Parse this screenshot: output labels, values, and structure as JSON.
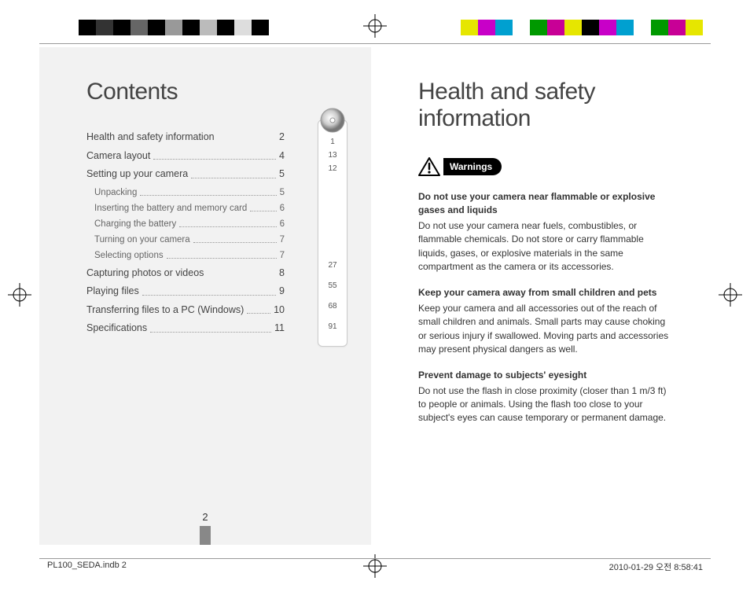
{
  "colorbars": {
    "left": [
      "#000",
      "#333",
      "#000",
      "#666",
      "#000",
      "#999",
      "#000",
      "#bbb",
      "#000",
      "#ddd",
      "#000",
      "#fff"
    ],
    "right": [
      "#e6e600",
      "#c800c8",
      "#00a0d0",
      "#fff",
      "#009900",
      "#c80096",
      "#e6e600",
      "#000",
      "#c800c8",
      "#00a0d0",
      "#fff",
      "#009900",
      "#c80096",
      "#e6e600"
    ]
  },
  "left": {
    "title": "Contents",
    "toc": [
      {
        "label": "Health and safety information",
        "page": "2",
        "style": "nodots"
      },
      {
        "label": "Camera layout",
        "page": "4"
      },
      {
        "label": "Setting up your camera",
        "page": "5"
      }
    ],
    "toc_sub": [
      {
        "label": "Unpacking",
        "page": "5"
      },
      {
        "label": "Inserting the battery and memory card",
        "page": "6"
      },
      {
        "label": "Charging the battery",
        "page": "6"
      },
      {
        "label": "Turning on your camera",
        "page": "7"
      },
      {
        "label": "Selecting options",
        "page": "7"
      }
    ],
    "toc2": [
      {
        "label": "Capturing photos or videos",
        "page": "8",
        "style": "nodots"
      },
      {
        "label": "Playing files",
        "page": "9"
      },
      {
        "label": "Transferring files to a PC (Windows)",
        "page": "10"
      },
      {
        "label": "Specifications",
        "page": "11"
      }
    ],
    "thumb": [
      "1",
      "13",
      "12",
      "27",
      "55",
      "68",
      "91"
    ],
    "pagenum": "2"
  },
  "right": {
    "title": "Health and safety information",
    "warnings_label": "Warnings",
    "sections": [
      {
        "title": "Do not use your camera near flammable or explosive gases and liquids",
        "body": "Do not use your camera near fuels, combustibles, or flammable chemicals. Do not store or carry flammable liquids, gases, or explosive materials in the same compartment as the camera or its accessories."
      },
      {
        "title": "Keep your camera away from small children and pets",
        "body": "Keep your camera and all accessories out of the reach of small children and animals. Small parts may cause choking or serious injury if swallowed. Moving parts and accessories may present physical dangers as well."
      },
      {
        "title": "Prevent damage to subjects' eyesight",
        "body": "Do not use the flash in close proximity (closer than 1 m/3 ft) to people or animals. Using the flash too close to your subject's eyes can cause temporary or permanent damage."
      }
    ]
  },
  "footer": {
    "file": "PL100_SEDA.indb   2",
    "timestamp": "2010-01-29   오전 8:58:41"
  }
}
